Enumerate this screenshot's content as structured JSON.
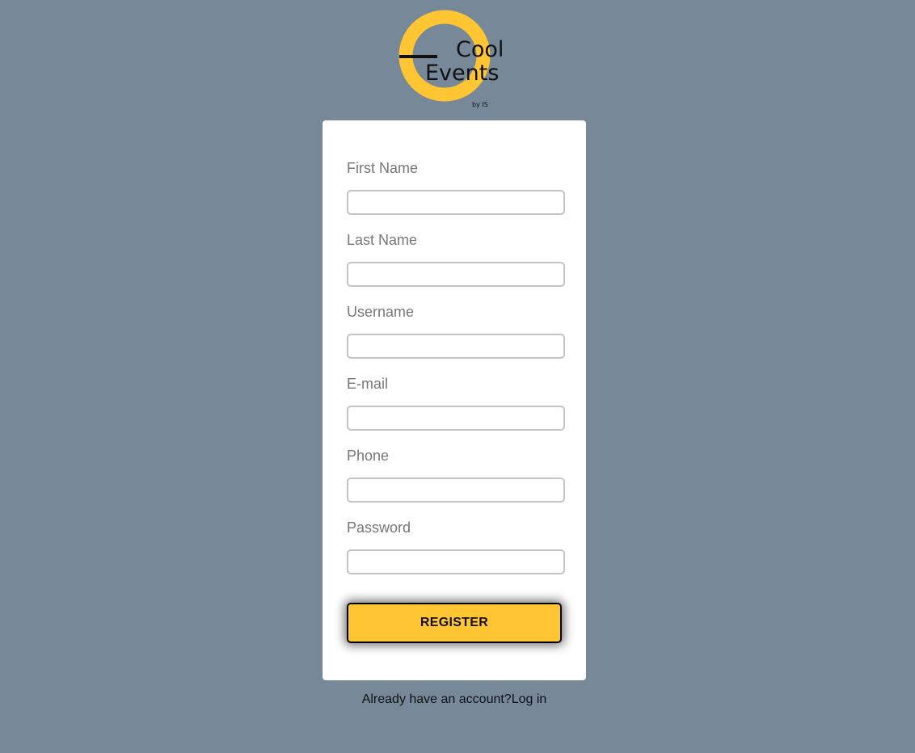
{
  "brand": {
    "logo_line1": "Cool",
    "logo_line2": "Events",
    "logo_byline": "by IS",
    "accent_color": "#ffc533",
    "background_color": "#778899"
  },
  "form": {
    "fields": [
      {
        "label": "First Name",
        "value": "",
        "placeholder": ""
      },
      {
        "label": "Last Name",
        "value": "",
        "placeholder": ""
      },
      {
        "label": "Username",
        "value": "",
        "placeholder": ""
      },
      {
        "label": "E-mail",
        "value": "",
        "placeholder": ""
      },
      {
        "label": "Phone",
        "value": "",
        "placeholder": ""
      },
      {
        "label": "Password",
        "value": "",
        "placeholder": ""
      }
    ],
    "submit_label": "REGISTER"
  },
  "footer": {
    "prompt_text": "Already have an account?",
    "login_link": "Log in"
  }
}
